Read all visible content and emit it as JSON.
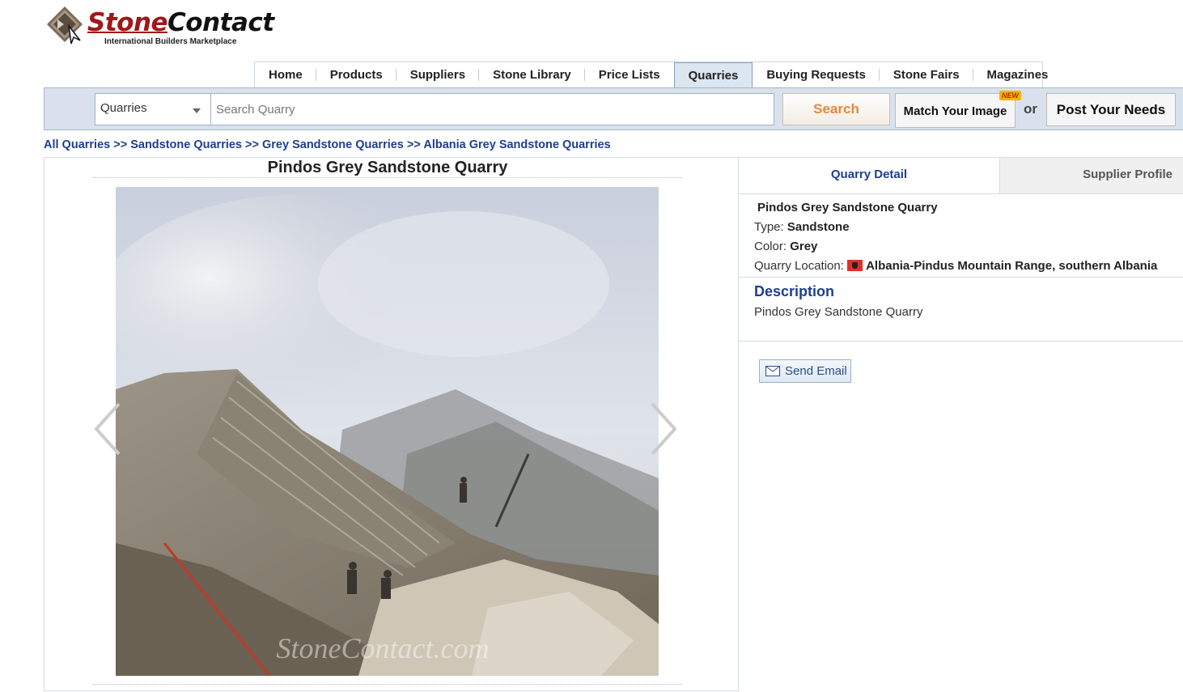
{
  "logo": {
    "word1": "Stone",
    "word2": "Contact",
    "tagline": "International Builders Marketplace"
  },
  "nav": {
    "items": [
      "Home",
      "Products",
      "Suppliers",
      "Stone Library",
      "Price Lists",
      "Quarries",
      "Buying Requests",
      "Stone Fairs",
      "Magazines"
    ],
    "active": "Quarries"
  },
  "search": {
    "category": "Quarries",
    "placeholder": "Search Quarry",
    "search_label": "Search",
    "match_label": "Match Your Image",
    "new_badge": "NEW",
    "or_text": "or",
    "post_label": "Post Your Needs"
  },
  "breadcrumb": {
    "items": [
      "All Quarries",
      "Sandstone Quarries",
      "Grey Sandstone Quarries",
      "Albania Grey Sandstone Quarries"
    ],
    "separator": ">>"
  },
  "product": {
    "title": "Pindos Grey Sandstone Quarry",
    "watermark": "StoneContact.com"
  },
  "tabs": {
    "detail": "Quarry Detail",
    "supplier": "Supplier Profile"
  },
  "details": {
    "name": "Pindos Grey Sandstone Quarry",
    "type_label": "Type:",
    "type_value": "Sandstone",
    "color_label": "Color:",
    "color_value": "Grey",
    "location_label": "Quarry Location:",
    "location_value": "Albania-Pindus Mountain Range, southern Albania"
  },
  "description": {
    "heading": "Description",
    "text": "Pindos Grey Sandstone Quarry"
  },
  "email_button": "Send Email",
  "colors": {
    "link": "#1d3f8f",
    "search_text": "#e8873a",
    "brand_red": "#a01818"
  }
}
